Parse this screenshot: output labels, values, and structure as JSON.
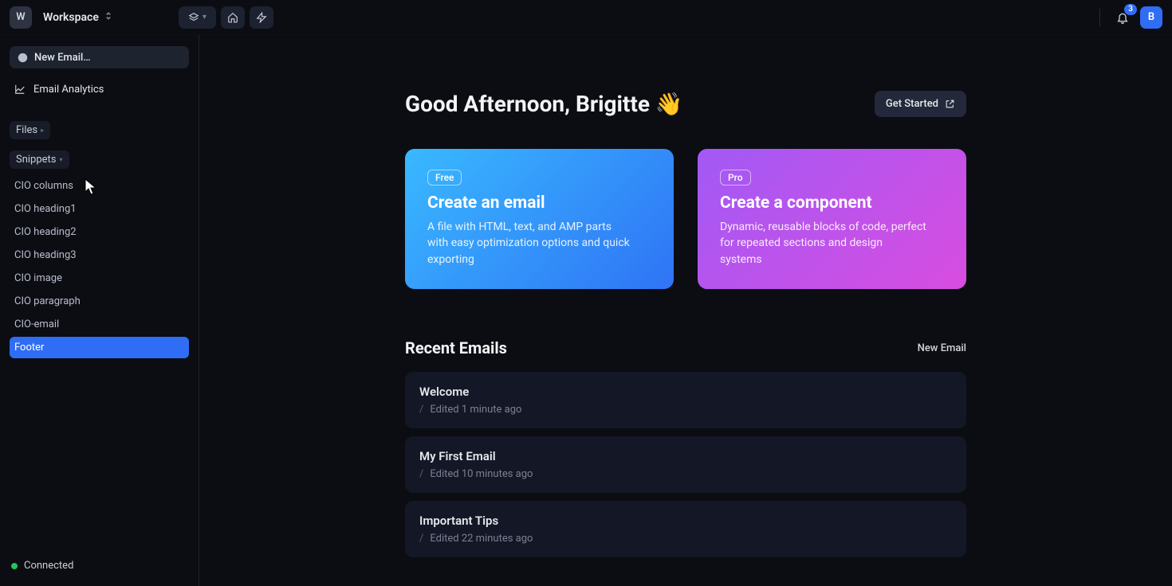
{
  "topbar": {
    "workspace_initial": "W",
    "workspace_name": "Workspace",
    "notification_count": "3",
    "avatar_initial": "B"
  },
  "sidebar": {
    "new_email_label": "New Email…",
    "analytics_label": "Email Analytics",
    "sections": {
      "files_label": "Files",
      "snippets_label": "Snippets"
    },
    "snippets": [
      "CIO columns",
      "CIO heading1",
      "CIO heading2",
      "CIO heading3",
      "CIO image",
      "CIO paragraph",
      "CIO-email",
      "Footer"
    ],
    "selected_snippet_index": 7,
    "status_label": "Connected"
  },
  "main": {
    "greeting": "Good Afternoon, Brigitte 👋",
    "get_started_label": "Get Started",
    "cards": [
      {
        "tier": "Free",
        "title": "Create an email",
        "desc": "A file with HTML, text, and AMP parts with easy optimization options and quick exporting",
        "variant": "blue"
      },
      {
        "tier": "Pro",
        "title": "Create a component",
        "desc": "Dynamic, reusable blocks of code, perfect for repeated sections and design systems",
        "variant": "purple"
      }
    ],
    "recent_heading": "Recent Emails",
    "recent_new_label": "New Email",
    "recent": [
      {
        "title": "Welcome",
        "meta": "Edited 1 minute ago"
      },
      {
        "title": "My First Email",
        "meta": "Edited 10 minutes ago"
      },
      {
        "title": "Important Tips",
        "meta": "Edited 22 minutes ago"
      }
    ]
  }
}
